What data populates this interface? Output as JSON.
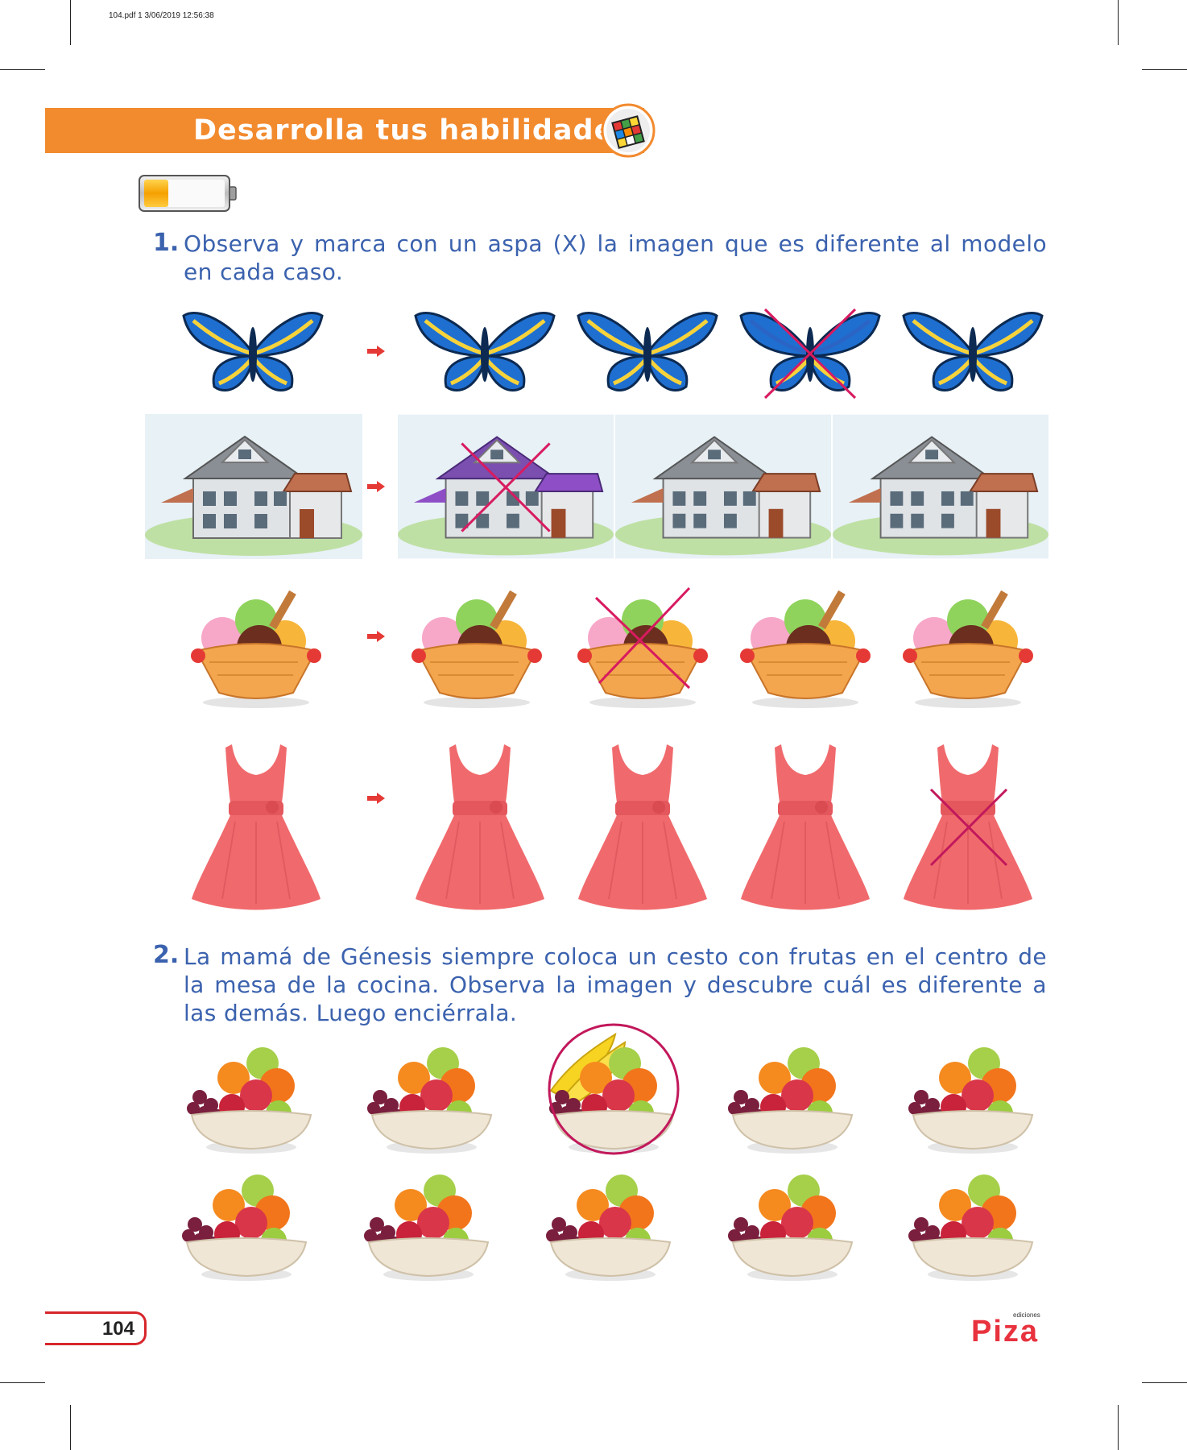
{
  "print_slug": "104.pdf   1   3/06/2019   12:56:38",
  "section_title": "Desarrolla tus habilidades",
  "icons": {
    "rubik_cube": "rubik-cube-icon",
    "battery": "battery-level-icon",
    "arrow": "red-arrow-icon"
  },
  "colors": {
    "banner": "#f28a2e",
    "text": "#3b62ae",
    "mark": "#d81b60",
    "butterfly": "#1f6fd1",
    "dress": "#f06a6d"
  },
  "battery_level": 0.3,
  "question1": {
    "number": "1.",
    "text": "Observa y marca con un aspa (X) la imagen que es diferente al modelo en cada caso.",
    "rows": [
      {
        "subject": "butterfly",
        "marked_index": 2
      },
      {
        "subject": "house",
        "marked_index": 0
      },
      {
        "subject": "ice-cream",
        "marked_index": 1
      },
      {
        "subject": "dress",
        "marked_index": 3
      }
    ]
  },
  "question2": {
    "number": "2.",
    "text": "La mamá de Génesis siempre coloca un cesto con frutas en el centro de la mesa de la cocina. Observa la imagen y descubre cuál es diferente a las demás. Luego enciérrala.",
    "circled_index": 2
  },
  "footer": {
    "page_number": "104",
    "brand_small": "ediciones",
    "brand": "Piza"
  }
}
